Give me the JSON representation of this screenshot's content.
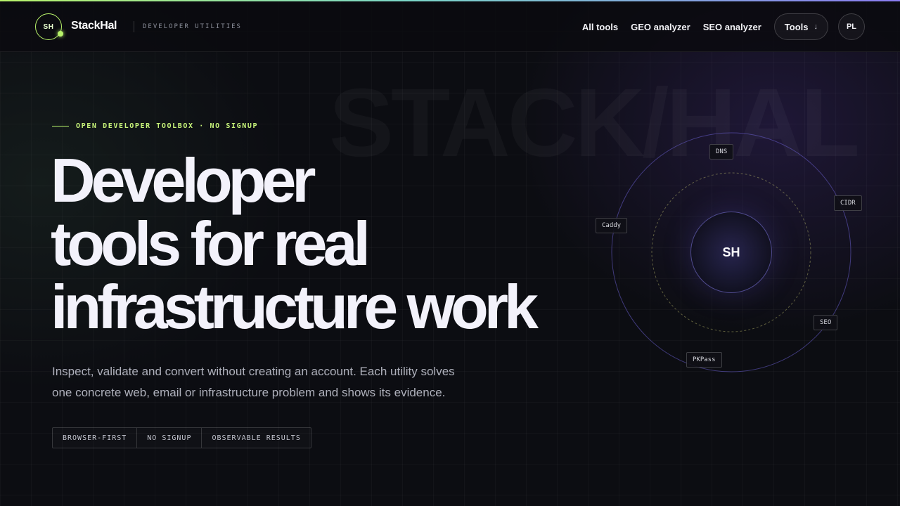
{
  "header": {
    "logo_mark": "SH",
    "brand": "StackHal",
    "tagline": "DEVELOPER UTILITIES",
    "nav": [
      "All tools",
      "GEO analyzer",
      "SEO analyzer"
    ],
    "tools_button": "Tools",
    "tools_arrow": "↓",
    "language": "PL"
  },
  "hero": {
    "watermark": "STACK/HAL",
    "eyebrow": "OPEN DEVELOPER TOOLBOX · NO SIGNUP",
    "headline_lines": [
      "Developer",
      "tools for real",
      "infrastructure work"
    ],
    "subtext_lines": [
      "Inspect, validate and convert without creating an account. Each utility solves",
      "one concrete web, email or infrastructure problem and shows its evidence."
    ],
    "chips": [
      "BROWSER-FIRST",
      "NO SIGNUP",
      "OBSERVABLE RESULTS"
    ]
  },
  "orbit": {
    "center": "SH",
    "tags": [
      "DNS",
      "CIDR",
      "Caddy",
      "SEO",
      "PKPass"
    ]
  },
  "colors": {
    "accent": "#b8f36a",
    "orbit": "#6a5fd0",
    "background": "#0c0d12"
  }
}
